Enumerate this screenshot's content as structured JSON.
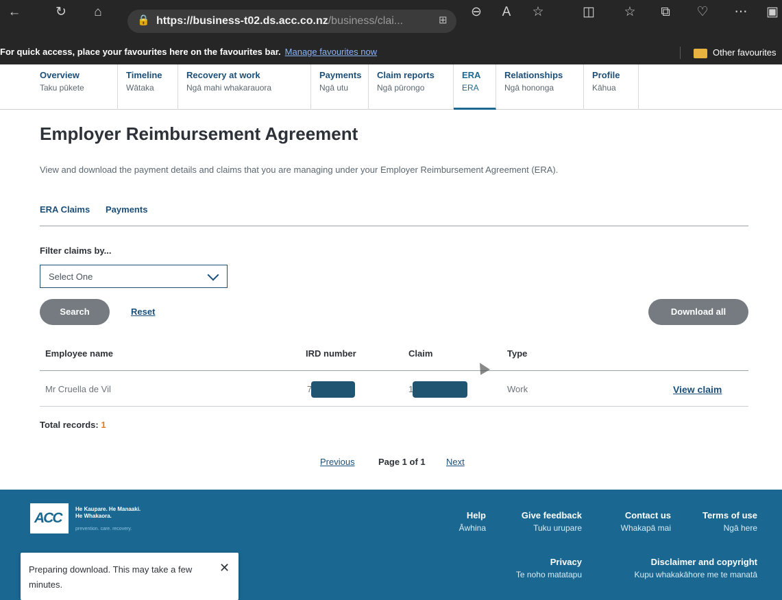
{
  "browser": {
    "url_host": "https://business-t02.ds.acc.co.nz",
    "url_path": "/business/clai...",
    "icons": [
      "back-icon",
      "refresh-icon",
      "home-icon",
      "lock-icon",
      "apps-icon",
      "zoom-icon",
      "read-aloud-icon",
      "favourite-star-icon",
      "split-screen-icon",
      "favourites-icon",
      "collections-icon",
      "health-icon",
      "more-icon",
      "sidebar-icon"
    ],
    "favbar_text": "For quick access, place your favourites here on the favourites bar.",
    "favbar_link": "Manage favourites now",
    "other_favourites": "Other favourites"
  },
  "nav": {
    "items": [
      {
        "en": "Overview",
        "mi": "Taku pūkete"
      },
      {
        "en": "Timeline",
        "mi": "Wātaka"
      },
      {
        "en": "Recovery at work",
        "mi": "Ngā mahi whakarauora"
      },
      {
        "en": "Payments",
        "mi": "Ngā utu"
      },
      {
        "en": "Claim reports",
        "mi": "Ngā pūrongo"
      },
      {
        "en": "ERA",
        "mi": "ERA"
      },
      {
        "en": "Relationships",
        "mi": "Ngā hononga"
      },
      {
        "en": "Profile",
        "mi": "Kāhua"
      }
    ],
    "active": "ERA"
  },
  "page": {
    "title": "Employer Reimbursement Agreement",
    "intro": "View and download the payment details and claims that you are managing under your Employer Reimbursement Agreement (ERA).",
    "tabs": [
      "ERA Claims",
      "Payments"
    ],
    "filter_label": "Filter claims by...",
    "filter_value": "Select One",
    "search_label": "Search",
    "reset_label": "Reset",
    "download_label": "Download all"
  },
  "table": {
    "headers": [
      "Employee name",
      "IRD number",
      "Claim",
      "Type"
    ],
    "rows": [
      {
        "employee": "Mr Cruella de Vil",
        "ird_prefix": "7",
        "claim_prefix": "1",
        "type": "Work",
        "action": "View claim"
      }
    ],
    "total_label": "Total records:",
    "total_value": "1"
  },
  "pager": {
    "previous": "Previous",
    "current": "Page 1 of 1",
    "next": "Next"
  },
  "footer": {
    "tagline1": "He Kaupare. He Manaaki.",
    "tagline2": "He Whakaora.",
    "tagline_sub": "prevention. care. recovery.",
    "logo": "ACC",
    "links": [
      {
        "en": "Help",
        "mi": "Āwhina"
      },
      {
        "en": "Give feedback",
        "mi": "Tuku urupare"
      },
      {
        "en": "Contact us",
        "mi": "Whakapā mai"
      },
      {
        "en": "Terms of use",
        "mi": "Ngā here"
      },
      {
        "en": "Privacy",
        "mi": "Te noho matatapu"
      },
      {
        "en": "Disclaimer and copyright",
        "mi": "Kupu whakakāhore me te manatā"
      }
    ]
  },
  "toast": {
    "message": "Preparing download. This may take a few minutes.",
    "close": "✕"
  },
  "colors": {
    "brand": "#1a6891",
    "link": "#1b4f79",
    "button": "#757b80",
    "accent": "#e07b24",
    "redaction": "#1f5571"
  }
}
